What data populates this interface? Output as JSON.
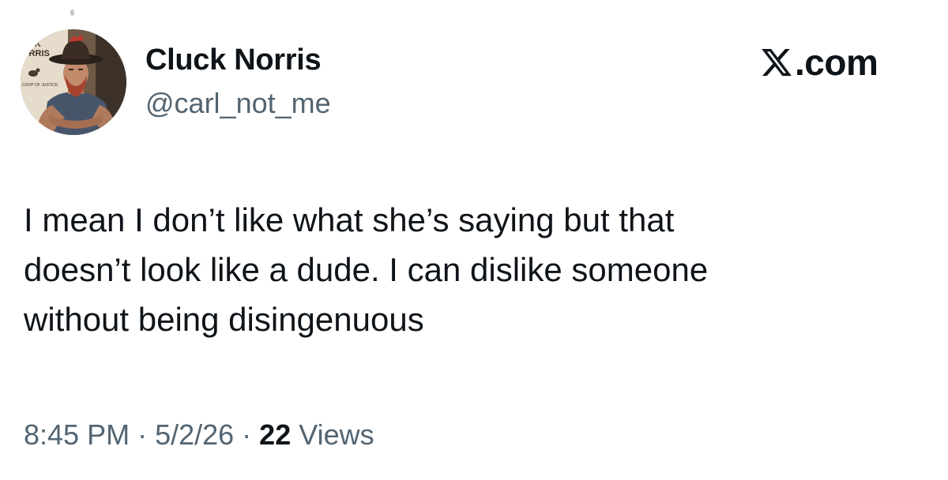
{
  "author": {
    "display_name": "Cluck Norris",
    "handle": "@carl_not_me",
    "avatar_badge_text": [
      "UCK",
      "ORRIS",
      "COOP OF JUSTICE"
    ]
  },
  "brand": {
    "icon": "x-logo-icon",
    "text": ".com"
  },
  "tweet": {
    "text": "I mean I don’t like what she’s saying but that\ndoesn’t look like a dude. I can dislike someone\nwithout being disingenuous"
  },
  "meta": {
    "time": "8:45 PM",
    "separator": "·",
    "date": "5/2/26",
    "views_count": "22",
    "views_label": "Views"
  },
  "colors": {
    "text_primary": "#0f1419",
    "text_secondary": "#536471",
    "background": "#ffffff"
  }
}
